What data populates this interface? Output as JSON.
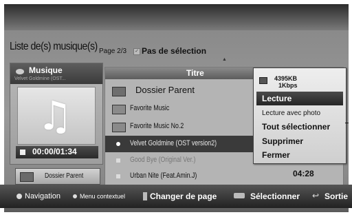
{
  "header": {
    "title": "Liste de(s) musique(s)",
    "page": "Page 2/3",
    "selection_status": "Pas de sélection"
  },
  "preview": {
    "label": "Musique",
    "track_name": "Velvet Goldmine (OST...",
    "time": "00:00/01:34",
    "icon": "music-note-icon"
  },
  "parent_button": {
    "label": "Dossier Parent"
  },
  "list": {
    "column_header": "Titre",
    "rows": [
      {
        "label": "Dossier Parent",
        "type": "parent"
      },
      {
        "label": "Favorite Music",
        "type": "folder"
      },
      {
        "label": "Favorite Music No.2",
        "type": "folder"
      },
      {
        "label": "Velvet Goldmine (OST version2)",
        "type": "track"
      },
      {
        "label": "Good Bye (Original Ver.)",
        "type": "track"
      },
      {
        "label": "Urban Nite (Feat.Amin.J)",
        "type": "track"
      }
    ],
    "duration": "04:28"
  },
  "context_menu": {
    "file_size": "4395KB",
    "bitrate": "1Kbps",
    "items": [
      {
        "label": "Lecture"
      },
      {
        "label": "Lecture avec photo"
      },
      {
        "label": "Tout sélectionner"
      },
      {
        "label": "Supprimer"
      },
      {
        "label": "Fermer"
      }
    ]
  },
  "footer": {
    "navigation": "Navigation",
    "context_menu": "Menu contextuel",
    "change_page": "Changer de page",
    "select": "Sélectionner",
    "exit": "Sortie"
  },
  "colors": {
    "highlight": "#2e2e2e",
    "menu_bg": "#e4e4e4",
    "footer_bg": "#333333"
  }
}
